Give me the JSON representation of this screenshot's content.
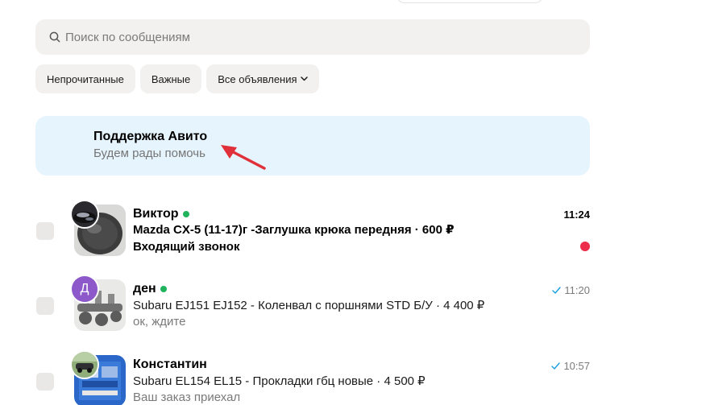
{
  "search": {
    "placeholder": "Поиск по сообщениям",
    "icon": "search-icon"
  },
  "filters": [
    {
      "label": "Непрочитанные"
    },
    {
      "label": "Важные"
    },
    {
      "label": "Все объявления",
      "icon": "chevron-down-icon"
    }
  ],
  "support": {
    "title": "Поддержка Авито",
    "subtitle": "Будем рады помочь"
  },
  "annotation": {
    "color": "#e0303a"
  },
  "colors": {
    "online": "#1fb35b",
    "unread": "#ec2d4c",
    "check": "#1a9fe0",
    "support_bg": "#e6f4fd"
  },
  "chats": [
    {
      "name": "Виктор",
      "online": true,
      "item": "Mazda CX-5 (11-17)г -Заглушка крюка передняя · 600 ₽",
      "message": "Входящий звонок",
      "time": "11:24",
      "unread": true,
      "read_check": false
    },
    {
      "name": "ден",
      "online": true,
      "avatar_letter": "Д",
      "item": "Subaru EJ151 EJ152 - Коленвал с поршнями STD Б/У · 4 400 ₽",
      "message": "ок, ждите",
      "time": "11:20",
      "unread": false,
      "read_check": true
    },
    {
      "name": "Константин",
      "online": false,
      "item": "Subaru EL154 EL15 - Прокладки гбц новые · 4 500 ₽",
      "message": "Ваш заказ приехал",
      "time": "10:57",
      "unread": false,
      "read_check": true
    }
  ]
}
